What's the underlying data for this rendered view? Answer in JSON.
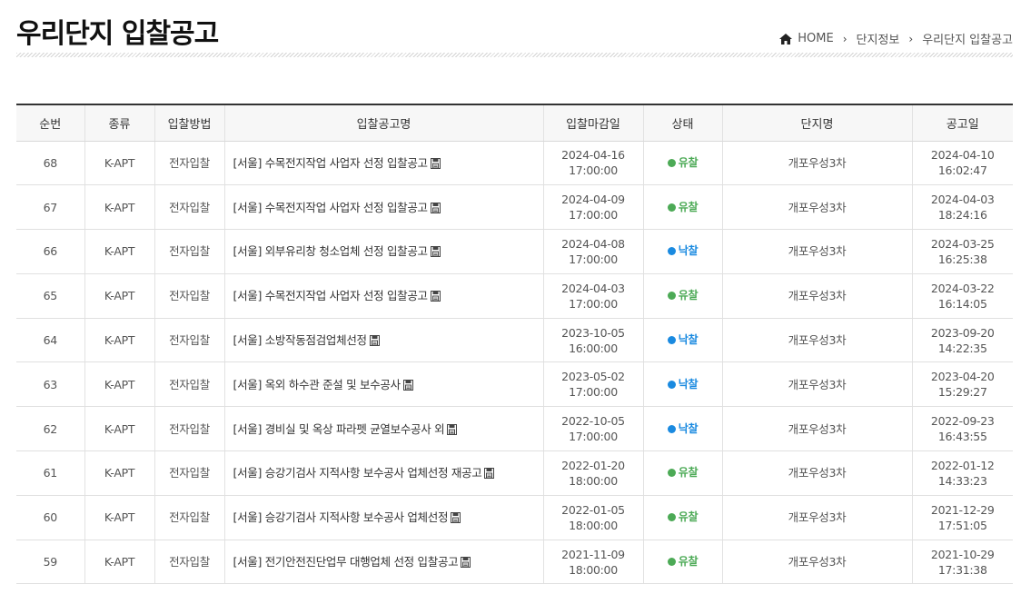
{
  "page": {
    "title": "우리단지 입찰공고"
  },
  "breadcrumb": {
    "home": "HOME",
    "level1": "단지정보",
    "level2": "우리단지 입찰공고"
  },
  "colors": {
    "status_fail": "#4caa56",
    "status_win": "#1a8ae0",
    "header_border": "#333333"
  },
  "table": {
    "headers": [
      "순번",
      "종류",
      "입찰방법",
      "입찰공고명",
      "입찰마감일",
      "상태",
      "단지명",
      "공고일"
    ],
    "rows": [
      {
        "no": "68",
        "type": "K-APT",
        "method": "전자입찰",
        "title": "[서울] 수목전지작업 사업자 선정 입찰공고",
        "deadline_date": "2024-04-16",
        "deadline_time": "17:00:00",
        "status": "유찰",
        "status_kind": "fail",
        "complex": "개포우성3차",
        "posted_date": "2024-04-10",
        "posted_time": "16:02:47"
      },
      {
        "no": "67",
        "type": "K-APT",
        "method": "전자입찰",
        "title": "[서울] 수목전지작업 사업자 선정 입찰공고",
        "deadline_date": "2024-04-09",
        "deadline_time": "17:00:00",
        "status": "유찰",
        "status_kind": "fail",
        "complex": "개포우성3차",
        "posted_date": "2024-04-03",
        "posted_time": "18:24:16"
      },
      {
        "no": "66",
        "type": "K-APT",
        "method": "전자입찰",
        "title": "[서울] 외부유리창 청소업체 선정 입찰공고",
        "deadline_date": "2024-04-08",
        "deadline_time": "17:00:00",
        "status": "낙찰",
        "status_kind": "win",
        "complex": "개포우성3차",
        "posted_date": "2024-03-25",
        "posted_time": "16:25:38"
      },
      {
        "no": "65",
        "type": "K-APT",
        "method": "전자입찰",
        "title": "[서울] 수목전지작업 사업자 선정 입찰공고",
        "deadline_date": "2024-04-03",
        "deadline_time": "17:00:00",
        "status": "유찰",
        "status_kind": "fail",
        "complex": "개포우성3차",
        "posted_date": "2024-03-22",
        "posted_time": "16:14:05"
      },
      {
        "no": "64",
        "type": "K-APT",
        "method": "전자입찰",
        "title": "[서울] 소방작동점검업체선정",
        "deadline_date": "2023-10-05",
        "deadline_time": "16:00:00",
        "status": "낙찰",
        "status_kind": "win",
        "complex": "개포우성3차",
        "posted_date": "2023-09-20",
        "posted_time": "14:22:35"
      },
      {
        "no": "63",
        "type": "K-APT",
        "method": "전자입찰",
        "title": "[서울] 옥외 하수관 준설 및 보수공사",
        "deadline_date": "2023-05-02",
        "deadline_time": "17:00:00",
        "status": "낙찰",
        "status_kind": "win",
        "complex": "개포우성3차",
        "posted_date": "2023-04-20",
        "posted_time": "15:29:27"
      },
      {
        "no": "62",
        "type": "K-APT",
        "method": "전자입찰",
        "title": "[서울] 경비실 및 옥상 파라펫 균열보수공사 외",
        "deadline_date": "2022-10-05",
        "deadline_time": "17:00:00",
        "status": "낙찰",
        "status_kind": "win",
        "complex": "개포우성3차",
        "posted_date": "2022-09-23",
        "posted_time": "16:43:55"
      },
      {
        "no": "61",
        "type": "K-APT",
        "method": "전자입찰",
        "title": "[서울] 승강기검사 지적사항 보수공사 업체선정 재공고",
        "deadline_date": "2022-01-20",
        "deadline_time": "18:00:00",
        "status": "유찰",
        "status_kind": "fail",
        "complex": "개포우성3차",
        "posted_date": "2022-01-12",
        "posted_time": "14:33:23"
      },
      {
        "no": "60",
        "type": "K-APT",
        "method": "전자입찰",
        "title": "[서울] 승강기검사 지적사항 보수공사 업체선정",
        "deadline_date": "2022-01-05",
        "deadline_time": "18:00:00",
        "status": "유찰",
        "status_kind": "fail",
        "complex": "개포우성3차",
        "posted_date": "2021-12-29",
        "posted_time": "17:51:05"
      },
      {
        "no": "59",
        "type": "K-APT",
        "method": "전자입찰",
        "title": "[서울] 전기안전진단업무 대행업체 선정 입찰공고",
        "deadline_date": "2021-11-09",
        "deadline_time": "18:00:00",
        "status": "유찰",
        "status_kind": "fail",
        "complex": "개포우성3차",
        "posted_date": "2021-10-29",
        "posted_time": "17:31:38"
      }
    ]
  }
}
